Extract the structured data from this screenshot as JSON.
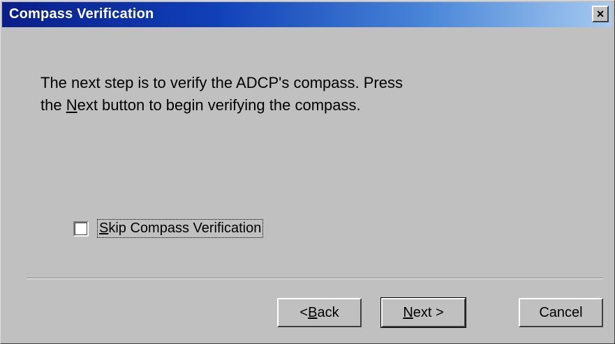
{
  "window": {
    "title": "Compass Verification",
    "close_glyph": "×"
  },
  "message": {
    "before_key": "The next step is to verify the ADCP's compass.  Press the ",
    "key_letter": "N",
    "after_key": "ext button to begin verifying the compass."
  },
  "skip_checkbox": {
    "checked": false,
    "key_letter": "S",
    "label_rest": "kip Compass Verification"
  },
  "buttons": {
    "back_prefix": "< ",
    "back_key": "B",
    "back_rest": "ack",
    "next_key": "N",
    "next_rest": "ext >",
    "cancel": "Cancel"
  },
  "colors": {
    "title_gradient_start": "#0a1e8a",
    "title_gradient_end": "#a6caf0",
    "face": "#c0c0c0"
  },
  "icons": {
    "close": "close-icon",
    "checkbox": "checkbox-unchecked"
  }
}
